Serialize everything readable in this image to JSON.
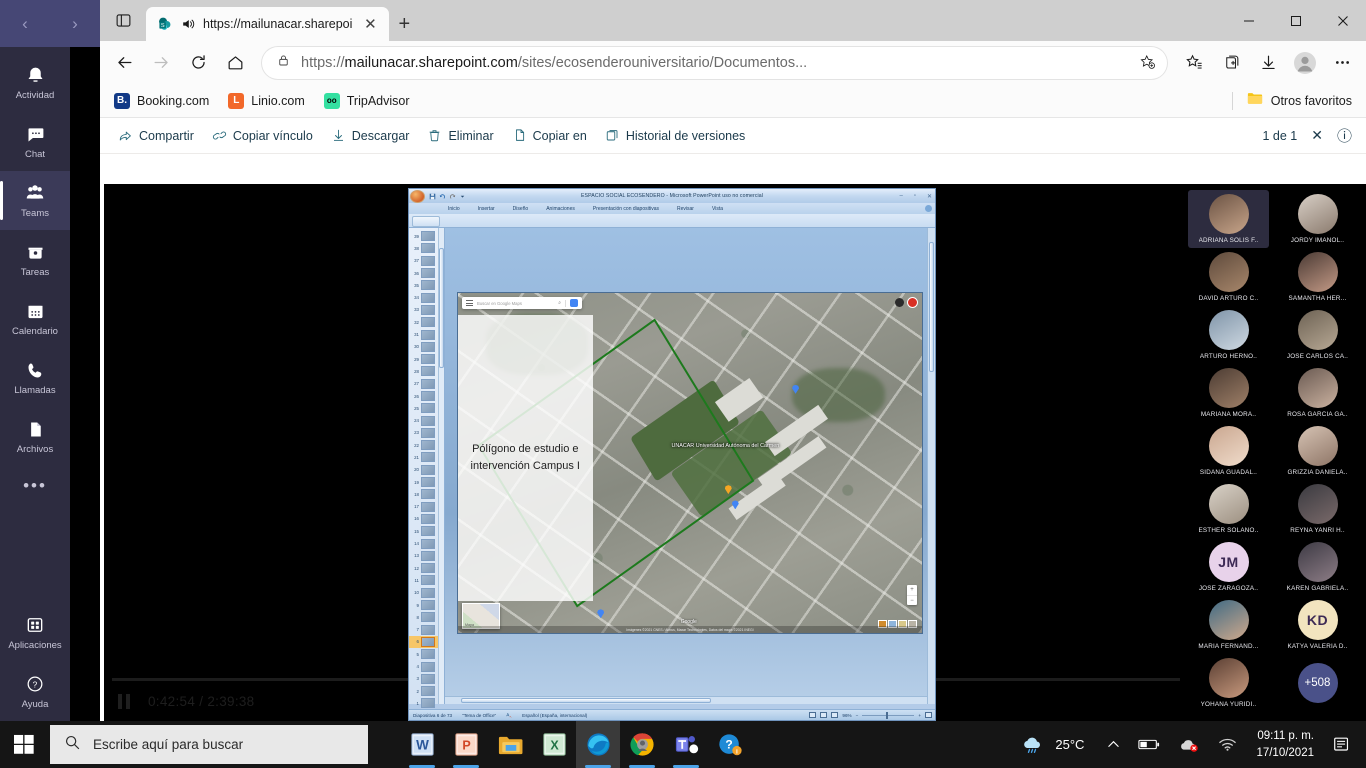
{
  "teams_rail": {
    "nav_back": "‹",
    "nav_forward": "›",
    "items": [
      {
        "label": "Actividad",
        "icon": "bell-icon",
        "active": false
      },
      {
        "label": "Chat",
        "icon": "chat-bubble-icon",
        "active": false
      },
      {
        "label": "Teams",
        "icon": "people-icon",
        "active": true
      },
      {
        "label": "Tareas",
        "icon": "tasks-icon",
        "active": false
      },
      {
        "label": "Calendario",
        "icon": "calendar-icon",
        "active": false
      },
      {
        "label": "Llamadas",
        "icon": "phone-icon",
        "active": false
      },
      {
        "label": "Archivos",
        "icon": "file-icon",
        "active": false
      }
    ],
    "overflow": "•••",
    "bottom_items": [
      {
        "label": "Aplicaciones",
        "icon": "apps-grid-icon"
      },
      {
        "label": "Ayuda",
        "icon": "help-circle-icon"
      }
    ]
  },
  "browser": {
    "tab": {
      "title": "https://mailunacar.sharepoi",
      "favicon": "sharepoint-icon",
      "audio_icon": "speaker-playing-icon",
      "close_icon": "close-icon"
    },
    "new_tab_label": "+",
    "window_controls": {
      "minimize": "—",
      "maximize": "▢",
      "close": "✕"
    },
    "toolbar": {
      "back": "back-arrow-icon",
      "forward": "forward-arrow-icon",
      "refresh": "refresh-icon",
      "home": "home-icon"
    },
    "omnibox": {
      "lock_icon": "lock-icon",
      "url_prefix": "https://",
      "url_domain": "mailunacar.sharepoint.com",
      "url_path": "/sites/ecosenderouniversitario/Documentos...",
      "favorite_icon": "star-add-icon"
    },
    "toolbar_right": [
      {
        "name": "favorites-icon",
        "glyph": "☆"
      },
      {
        "name": "collections-icon",
        "glyph": "⊞"
      },
      {
        "name": "downloads-icon",
        "glyph": "↓"
      },
      {
        "name": "profile-avatar",
        "glyph": "●"
      },
      {
        "name": "settings-more-icon",
        "glyph": "⋯"
      }
    ],
    "bookmarks": [
      {
        "label": "Booking.com",
        "icon_text": "B.",
        "color": "#123a87"
      },
      {
        "label": "Linio.com",
        "icon_text": "L",
        "color": "#f2682a"
      },
      {
        "label": "TripAdvisor",
        "icon_text": "oo",
        "color": "#34e0a1"
      }
    ],
    "other_favorites": {
      "label": "Otros favoritos",
      "icon": "folder-icon"
    }
  },
  "sharepoint_bar": {
    "commands": [
      {
        "label": "Compartir",
        "icon": "share-icon"
      },
      {
        "label": "Copiar vínculo",
        "icon": "link-icon"
      },
      {
        "label": "Descargar",
        "icon": "download-icon"
      },
      {
        "label": "Eliminar",
        "icon": "trash-icon"
      },
      {
        "label": "Copiar en",
        "icon": "copy-icon"
      },
      {
        "label": "Historial de versiones",
        "icon": "version-history-icon"
      }
    ],
    "page_count": "1 de 1",
    "close_icon": "✕",
    "info_icon": "ⓘ"
  },
  "video_player": {
    "pause_icon": "pause-icon",
    "current_time": "0:42:54",
    "separator": "/",
    "total_time": "2:39:38"
  },
  "powerpoint": {
    "title": "ESPACIO SOCIAL ECOSENDERO - Microsoft PowerPoint uso no comercial",
    "quick_access": [
      "save-icon",
      "undo-icon",
      "redo-icon",
      "customize-icon"
    ],
    "window_controls": {
      "minimize": "–",
      "maximize": "▫",
      "close": "✕"
    },
    "ribbon_tabs": [
      "Inicio",
      "Insertar",
      "Diseño",
      "Animaciones",
      "Presentación con diapositivas",
      "Revisar",
      "Vista"
    ],
    "slide_numbers": [
      "1",
      "2",
      "3",
      "4",
      "5",
      "6",
      "7",
      "8",
      "9",
      "10",
      "11",
      "12",
      "13",
      "14",
      "15",
      "16",
      "17",
      "18",
      "19",
      "20",
      "21",
      "22",
      "23",
      "24",
      "25",
      "26",
      "27",
      "28",
      "29",
      "30",
      "31",
      "32",
      "33",
      "34",
      "35",
      "36",
      "37",
      "38",
      "39"
    ],
    "selected_slide": "6",
    "status": {
      "slide_counter": "Diapositiva 6 de 73",
      "theme": "\"Tema de Office\"",
      "spellcheck_icon": "spellcheck-icon",
      "language": "Español (España, internacional)",
      "zoom": "96%",
      "zoom_out": "−",
      "zoom_in": "+",
      "fit_icon": "fit-to-window-icon",
      "views": [
        "normal-view-icon",
        "slide-sorter-icon",
        "reading-view-icon"
      ]
    },
    "slide": {
      "title_text": "Pólígono de estudio e intervención Campus I",
      "map": {
        "search_placeholder": "Buscar en Google Maps",
        "search_icon": "search-icon",
        "menu_icon": "hamburger-icon",
        "directions_icon": "directions-icon",
        "account_icon": "account-avatar-icon",
        "settings_icon": "settings-dot-icon",
        "place_label": "UNACAR Universidad Autónoma del Carmen",
        "watermark": "Google",
        "minimap_label": "Mapa",
        "zoom_in": "+",
        "zoom_out": "−",
        "attribution": "Imágenes ©2021 CNES / Airbus, Maxar Technologies, Datos del mapa ©2021 INEGI"
      }
    }
  },
  "participants": [
    {
      "name": "ADRIANA SOLIS F..",
      "type": "photo",
      "speaking": true,
      "colors": [
        "#6b5344",
        "#c8a58a"
      ]
    },
    {
      "name": "JORDY IMANOL..",
      "type": "photo",
      "speaking": false,
      "colors": [
        "#d8cfc6",
        "#8a7a6d"
      ]
    },
    {
      "name": "DAVID ARTURO C..",
      "type": "photo",
      "speaking": false,
      "colors": [
        "#5e4a3c",
        "#a8876b"
      ]
    },
    {
      "name": "SAMANTHA HER...",
      "type": "photo",
      "speaking": false,
      "colors": [
        "#4a3a34",
        "#c49a86"
      ]
    },
    {
      "name": "ARTURO HERNO..",
      "type": "photo",
      "speaking": false,
      "colors": [
        "#7f94a8",
        "#cfd9e2"
      ]
    },
    {
      "name": "JOSE CARLOS CA..",
      "type": "photo",
      "speaking": false,
      "colors": [
        "#6d6254",
        "#b7a894"
      ]
    },
    {
      "name": "MARIANA MORA..",
      "type": "photo",
      "speaking": false,
      "colors": [
        "#4c3c33",
        "#9f8068"
      ]
    },
    {
      "name": "ROSA GARCIA GA..",
      "type": "photo",
      "speaking": false,
      "colors": [
        "#6a5a52",
        "#cbb2a0"
      ]
    },
    {
      "name": "SIDANA GUADAL..",
      "type": "photo",
      "speaking": false,
      "colors": [
        "#c9a68f",
        "#f0dccb"
      ]
    },
    {
      "name": "GRIZZIA DANIELA..",
      "type": "photo",
      "speaking": false,
      "colors": [
        "#d6c3b4",
        "#8e7566"
      ]
    },
    {
      "name": "ESTHER SOLANO..",
      "type": "photo",
      "speaking": false,
      "colors": [
        "#d9d2c8",
        "#9c8f80"
      ]
    },
    {
      "name": "REYNA YANRI H..",
      "type": "photo",
      "speaking": false,
      "colors": [
        "#3a3a40",
        "#7a6a6a"
      ]
    },
    {
      "name": "JOSE ZARAGOZA..",
      "type": "initials",
      "initials": "JM",
      "speaking": false,
      "colors": [
        "#e8d2ea",
        "#e8d2ea"
      ]
    },
    {
      "name": "KAREN GABRIELA..",
      "type": "photo",
      "speaking": false,
      "colors": [
        "#3d3a44",
        "#8d7d86"
      ]
    },
    {
      "name": "MARIA FERNAND...",
      "type": "photo",
      "speaking": false,
      "colors": [
        "#3f6a84",
        "#d0a98c"
      ]
    },
    {
      "name": "KATYA VALERIA D..",
      "type": "initials",
      "initials": "KD",
      "speaking": false,
      "colors": [
        "#f2e4bf",
        "#f2e4bf"
      ]
    },
    {
      "name": "YOHANA YURIDI..",
      "type": "photo",
      "speaking": false,
      "colors": [
        "#5a3f33",
        "#c99a7e"
      ]
    },
    {
      "name": "+508",
      "type": "overflow",
      "speaking": false,
      "colors": [
        "#4a5189",
        "#4a5189"
      ]
    }
  ],
  "taskbar": {
    "start_icon": "windows-logo-icon",
    "search_placeholder": "Escribe aquí para buscar",
    "search_icon": "search-icon",
    "apps": [
      {
        "name": "word-icon",
        "active": false,
        "running": true
      },
      {
        "name": "powerpoint-icon",
        "active": false,
        "running": true
      },
      {
        "name": "file-explorer-icon",
        "active": false,
        "running": false
      },
      {
        "name": "excel-icon",
        "active": false,
        "running": false
      },
      {
        "name": "edge-icon",
        "active": true,
        "running": true
      },
      {
        "name": "chrome-icon",
        "active": false,
        "running": true
      },
      {
        "name": "teams-icon",
        "active": false,
        "running": true
      },
      {
        "name": "help-icon",
        "active": false,
        "running": false
      }
    ],
    "tray": {
      "weather_icon": "rain-cloud-icon",
      "temperature": "25°C",
      "chevron_icon": "^",
      "battery_icon": "battery-icon",
      "onedrive_icon": "onedrive-error-icon",
      "network_icon": "wifi-icon",
      "time": "09:11 p. m.",
      "date": "17/10/2021",
      "notifications_icon": "notification-icon"
    }
  }
}
